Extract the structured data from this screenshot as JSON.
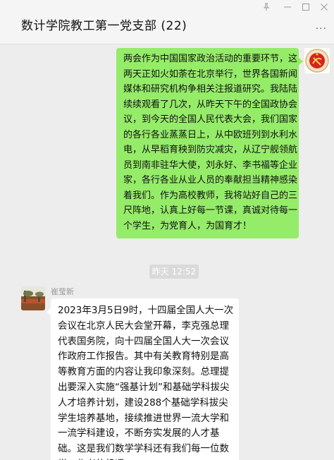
{
  "window": {
    "title": "数计学院教工第一党支部 (22)",
    "pin_icon": "pin-icon",
    "minimize_icon": "minimize-icon",
    "maximize_icon": "maximize-icon",
    "close_icon": "close-icon",
    "more_icon": "more-options-icon"
  },
  "messages": [
    {
      "side": "right",
      "text": "两会作为中国国家政治活动的重要环节，这两天正如火如荼在北京举行，世界各国新闻媒体和研究机构争相关注报道研究。我陆陆续续观看了几次，从昨天下午的全国政协会议，到今天的全国人民代表大会，我们国家的各行各业蒸蒸日上，从中欧班列到水利水电，从早稻育秧到防灾减灾，从辽宁舰领航员到南非驻华大使，刘永好、李书福等企业家，各行各业从业人员的奉献担当精神感染着我们。作为高校教师，我将站好自己的三尺阵地，认真上好每一节课，真诚对待每一个学生，为党育人，为国育才！"
    }
  ],
  "timestamp": "昨天 12:52",
  "incoming": {
    "sender": "崔莹新",
    "text": "2023年3月5日9时，十四届全国人大一次会议在北京人民大会堂开幕，李克强总理代表国务院，向十四届全国人大一次会议作政府工作报告。其中有关教育特别是高等教育方面的内容让我印象深刻。总理提出要深入实施“强基计划”和基础学科拔尖人才培养计划，建设288个基础学科拔尖学生培养基地，接续推进世界一流大学和一流学科建设，不断夯实发展的人才基础。这是我们数学学科还有我们每一位数学工作者的机遇。"
  },
  "colors": {
    "outgoing_bubble": "#95ec69",
    "incoming_bubble": "#ffffff",
    "background": "#ededed"
  }
}
